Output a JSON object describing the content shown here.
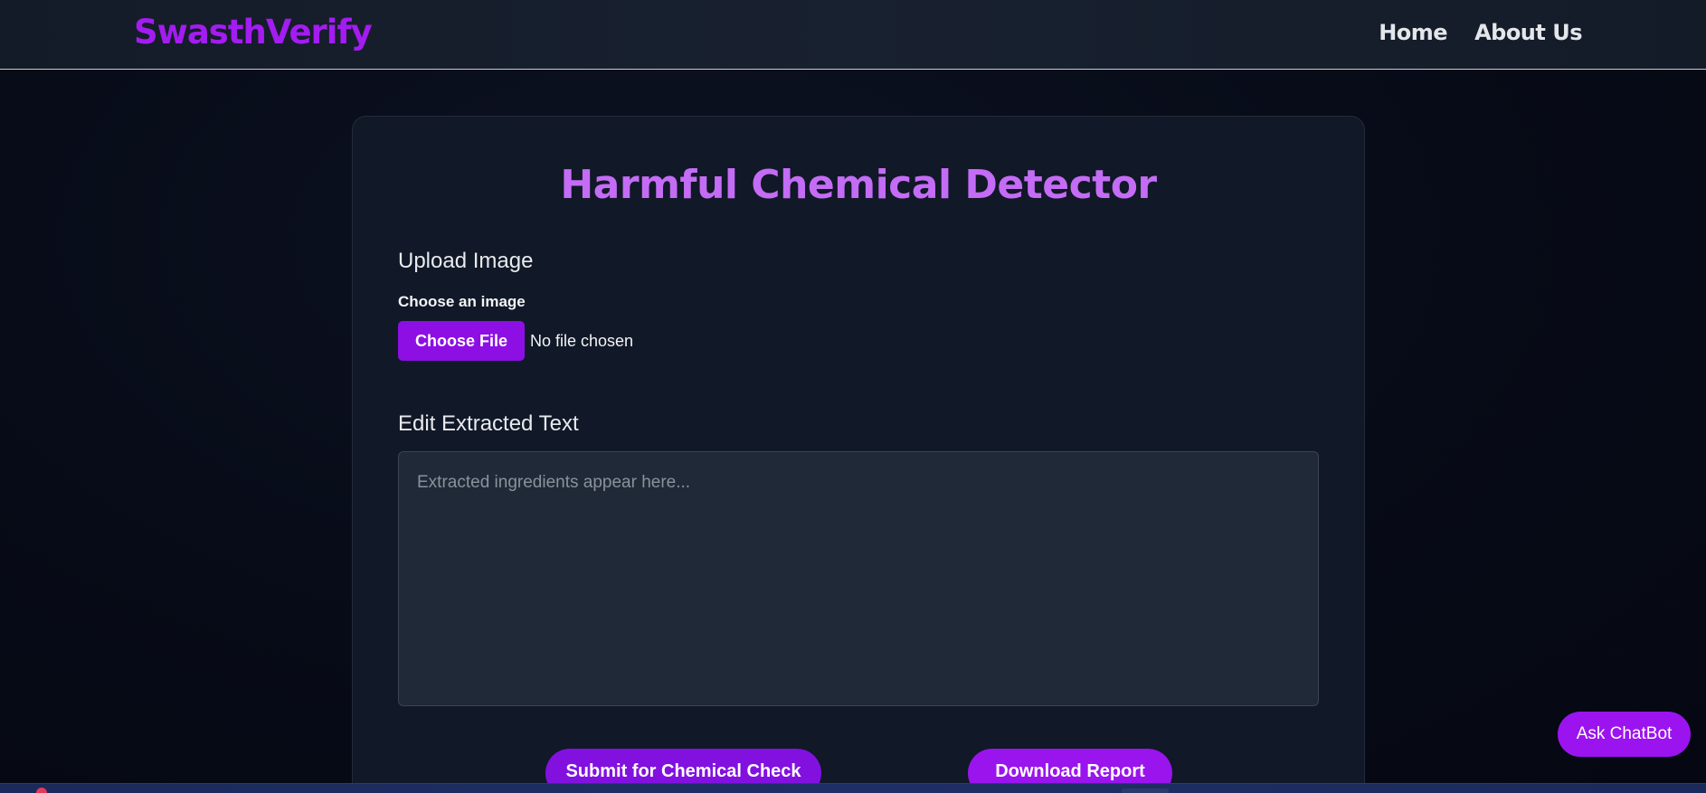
{
  "nav": {
    "brand": "SwasthVerify",
    "links": [
      "Home",
      "About Us"
    ]
  },
  "main": {
    "title": "Harmful Chemical Detector",
    "upload": {
      "heading": "Upload Image",
      "label": "Choose an image",
      "button_label": "Choose File",
      "status": "No file chosen"
    },
    "edit": {
      "heading": "Edit Extracted Text",
      "placeholder": "Extracted ingredients appear here...",
      "value": ""
    },
    "actions": {
      "submit_label": "Submit for Chemical Check",
      "download_label": "Download Report"
    }
  },
  "chatbot": {
    "label": "Ask ChatBot"
  },
  "colors": {
    "brand": "#a31cf0",
    "title": "#c46cf5",
    "primary_button": "#8d0fe4",
    "background": "#070b17",
    "card": "#111827"
  }
}
